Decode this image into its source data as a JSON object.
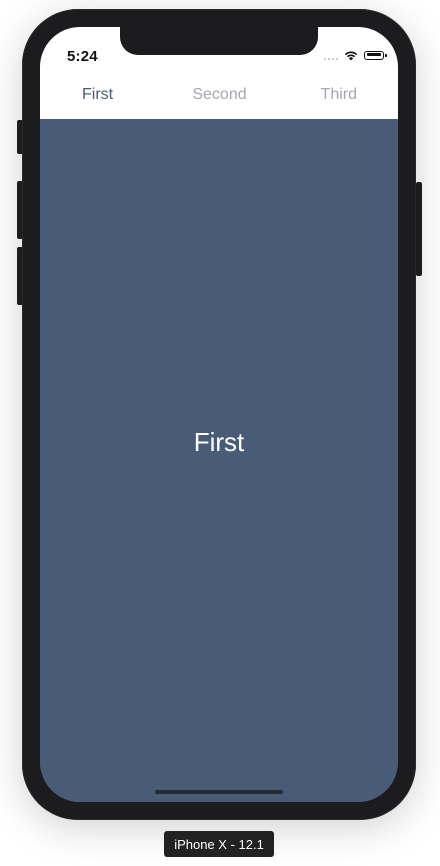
{
  "status_bar": {
    "time": "5:24"
  },
  "tabs": [
    {
      "label": "First",
      "active": true
    },
    {
      "label": "Second",
      "active": false
    },
    {
      "label": "Third",
      "active": false
    }
  ],
  "content": {
    "label": "First"
  },
  "device": {
    "label": "iPhone X - 12.1"
  },
  "colors": {
    "accent": "#485c78",
    "inactive_tab": "#a4a7ad",
    "device_frame": "#1c1c1e"
  },
  "icons": [
    "cellular-signal-icon",
    "wifi-icon",
    "battery-icon"
  ]
}
